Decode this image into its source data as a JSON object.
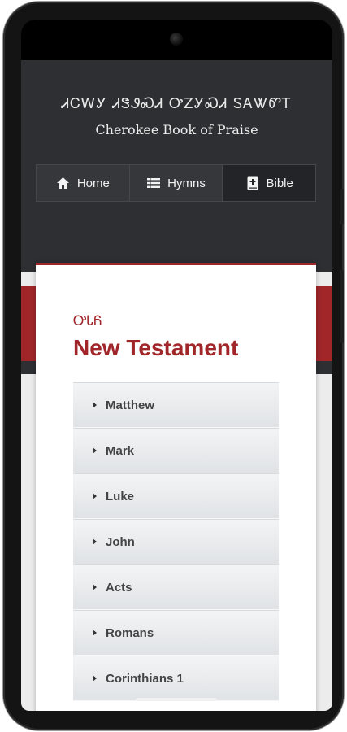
{
  "header": {
    "title_cherokee": "ᏗᏟᎳᎩ ᏗᏕᏭᏍᏗ ᎤᏃᎩᏍᏗ ᏚᎪᏔᏛᎢ",
    "title_english": "Cherokee Book of Praise"
  },
  "nav": {
    "items": [
      {
        "label": "Home",
        "icon": "home-icon"
      },
      {
        "label": "Hymns",
        "icon": "list-icon"
      },
      {
        "label": "Bible",
        "icon": "bible-icon",
        "active": true
      }
    ]
  },
  "section": {
    "title_cherokee": "ᎤᏓᏲ",
    "title": "New Testament"
  },
  "books": [
    "Matthew",
    "Mark",
    "Luke",
    "John",
    "Acts",
    "Romans",
    "Corinthians 1"
  ],
  "colors": {
    "accent": "#a0262a",
    "header_bg": "#2d2f33"
  }
}
